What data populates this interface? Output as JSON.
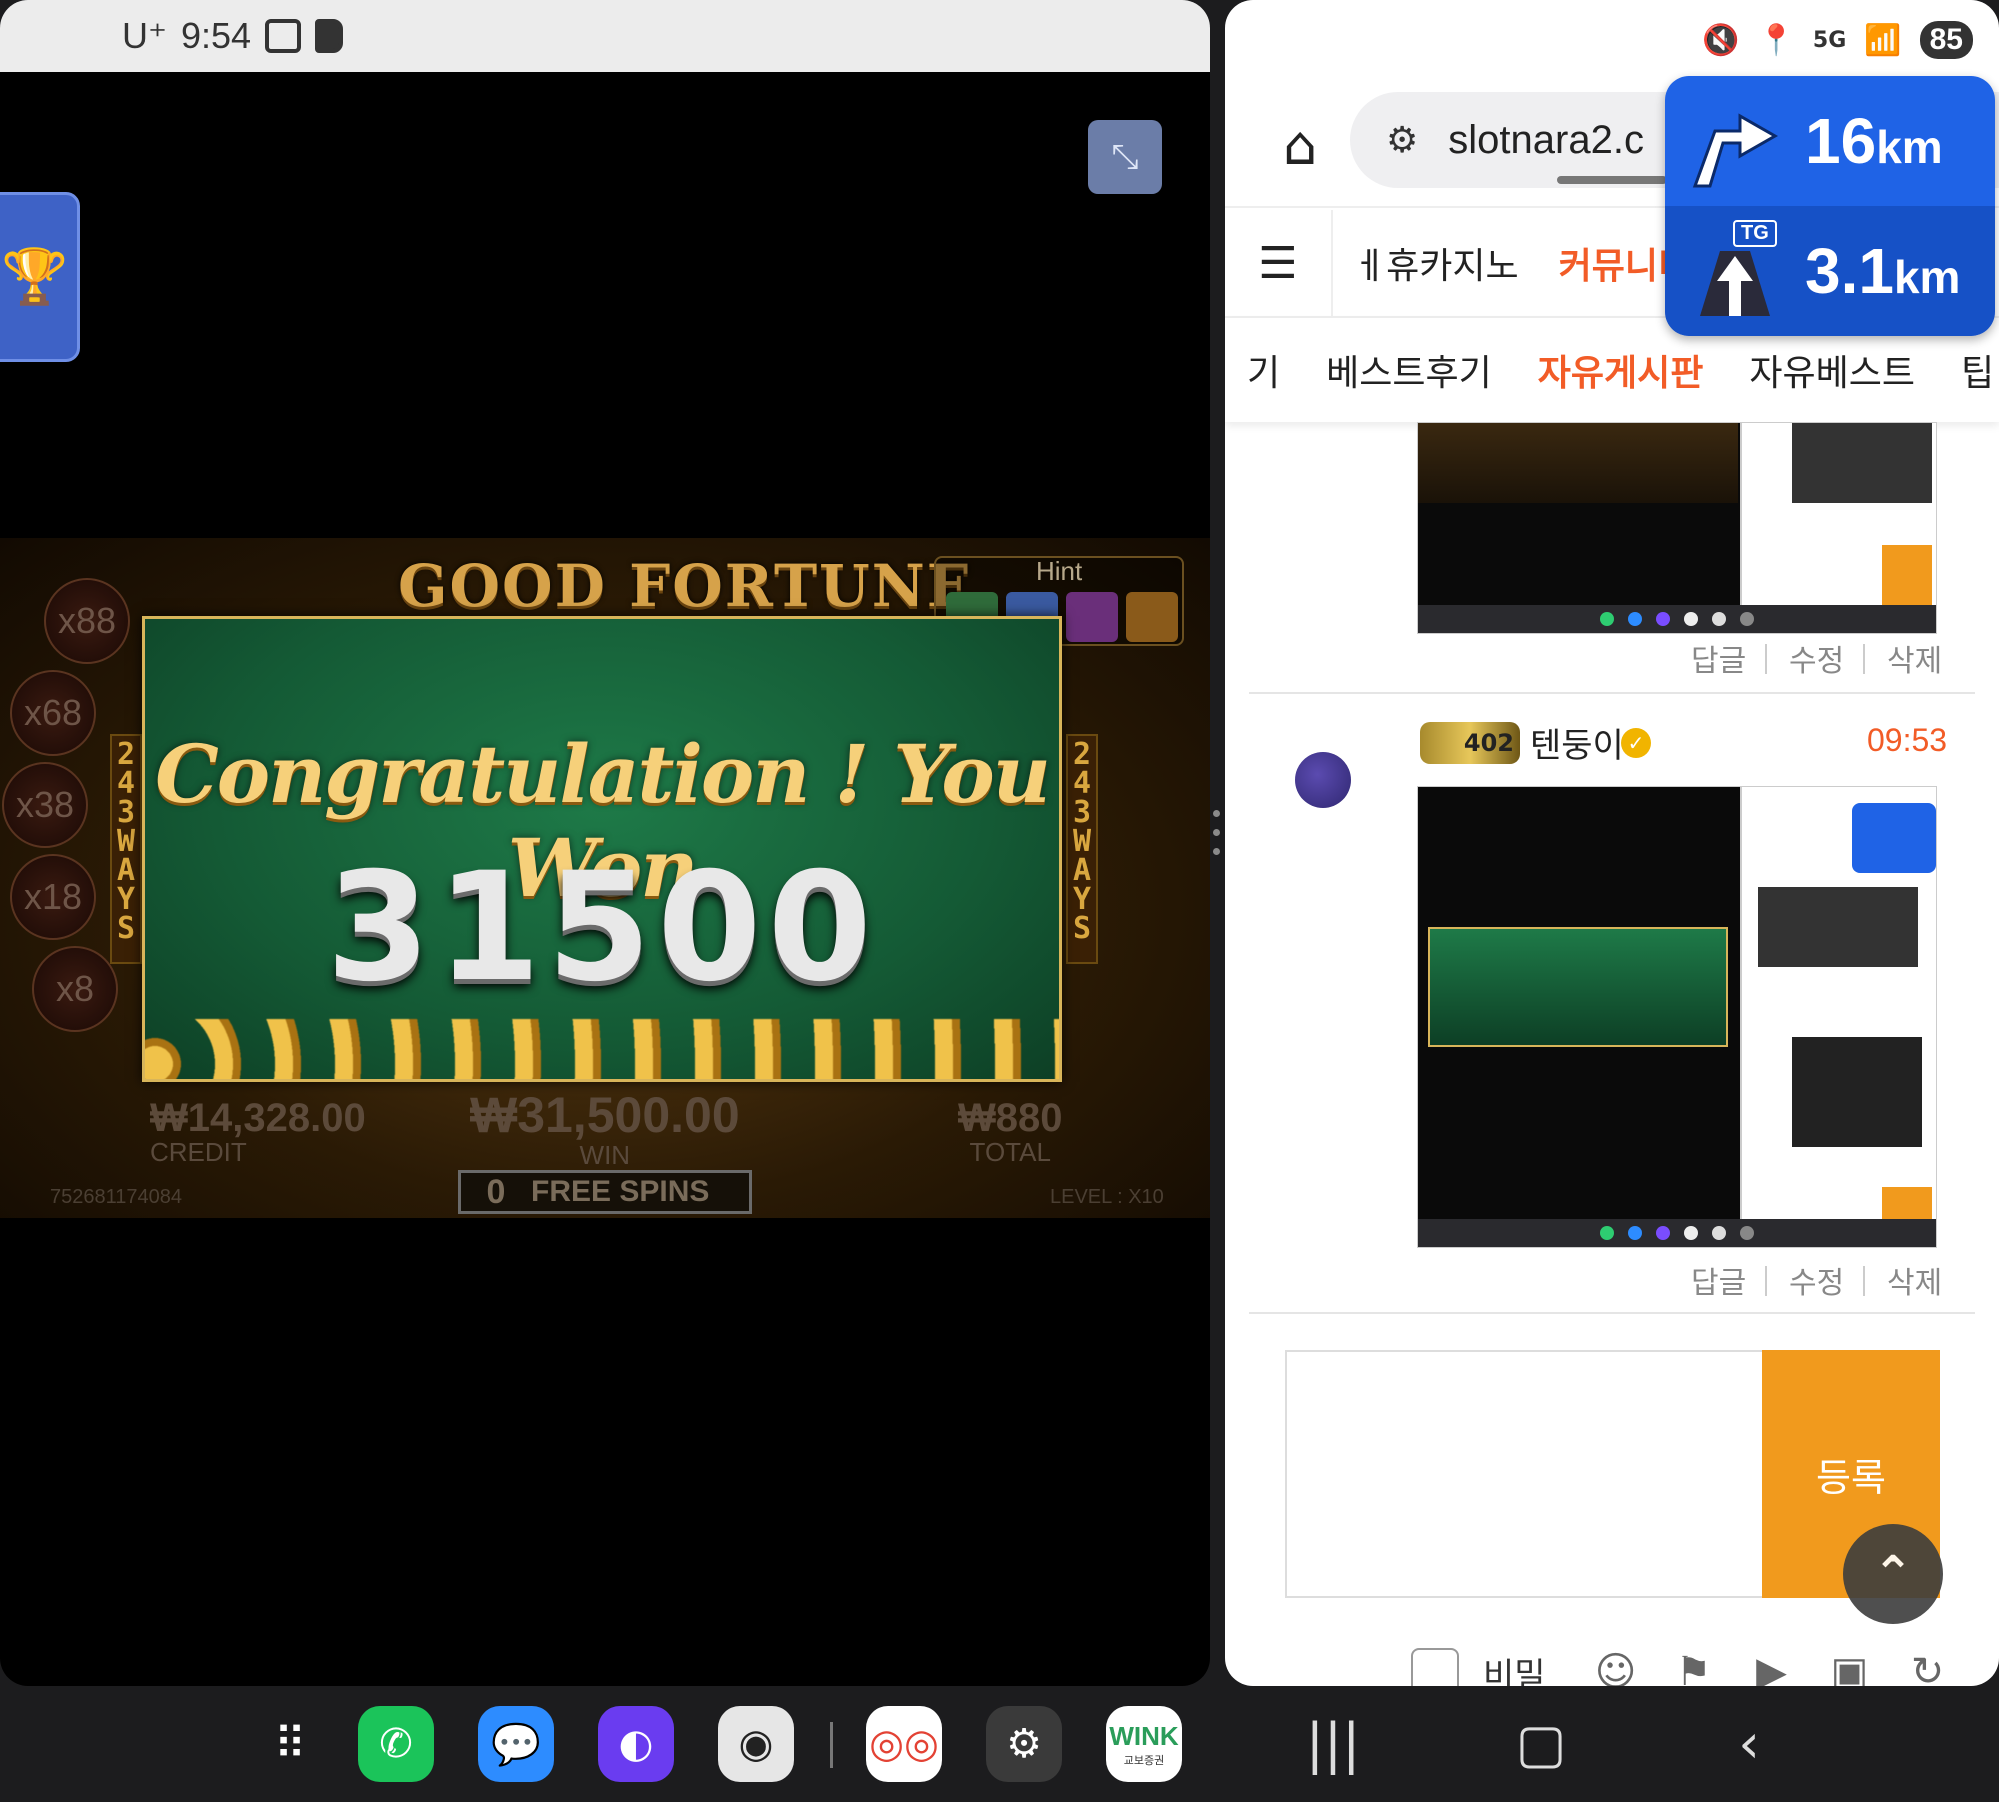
{
  "status_left": {
    "carrier": "U⁺",
    "time": "9:54"
  },
  "status_right": {
    "network": "5G",
    "battery": "85"
  },
  "game": {
    "title": "GOOD FORTUNE",
    "hint_label": "Hint",
    "multipliers": [
      "x88",
      "x68",
      "x38",
      "x18",
      "x8"
    ],
    "ways_left": "243WAYS",
    "ways_right": "243WAYS",
    "popup_title": "Congratulation ! You Won",
    "popup_amount": "31500",
    "credit_value": "₩14,328.00",
    "credit_label": "CREDIT",
    "win_value": "₩31,500.00",
    "win_label": "WIN",
    "total_value": "₩880",
    "total_label": "TOTAL",
    "free_spins_count": "0",
    "free_spins_label": "FREE SPINS",
    "round_id": "752681174084",
    "level": "LEVEL : X10"
  },
  "browser": {
    "url": "slotnara2.c",
    "nav1": [
      "ㅔ휴카지노",
      "커뮤니티"
    ],
    "nav2": [
      "기",
      "베스트후기",
      "자유게시판",
      "자유베스트",
      "팁"
    ],
    "comment_actions": [
      "답글",
      "수정",
      "삭제"
    ],
    "comment2": {
      "badge_level": "402",
      "username": "텐둥이",
      "time": "09:53"
    },
    "submit_label": "등록",
    "secret_label": "비밀"
  },
  "navigation_overlay": {
    "dist1": "16",
    "unit1": "km",
    "dist2": "3.1",
    "unit2": "km",
    "tag": "TG"
  },
  "dock": {
    "apps": [
      "apps-grid",
      "phone",
      "messages",
      "internet",
      "camera",
      "chrome-pair",
      "settings",
      "wink"
    ],
    "wink_label": "WINK",
    "wink_sub": "교보증권"
  },
  "colors": {
    "accent_orange": "#f25c27",
    "submit_orange": "#f19a1d",
    "nav_blue": "#1f63e6",
    "popup_green": "#145a35"
  }
}
